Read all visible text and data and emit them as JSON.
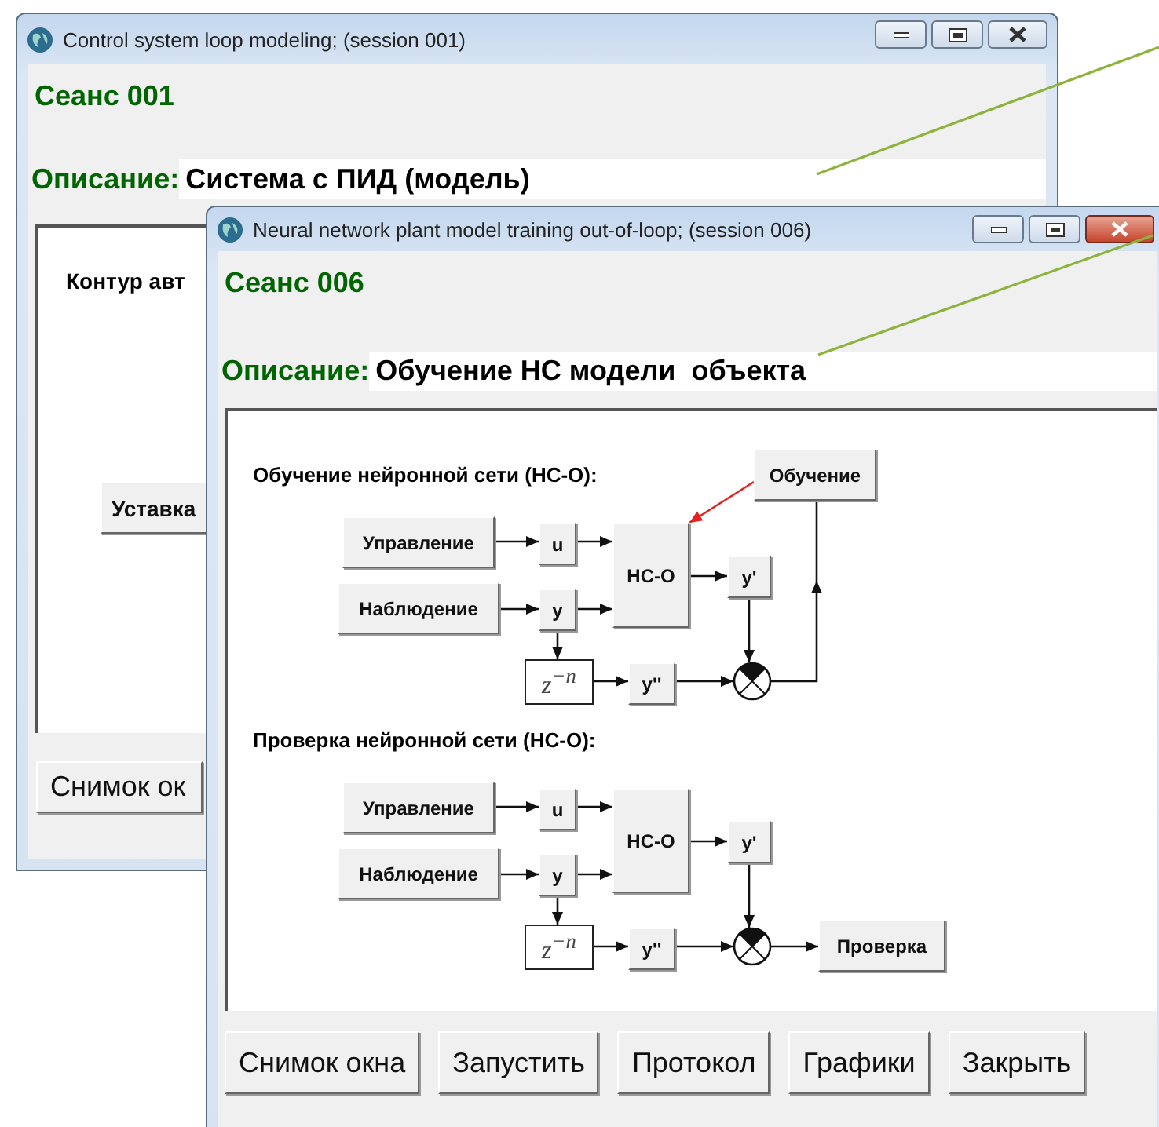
{
  "back_window": {
    "title": "Control system loop modeling; (session 001)",
    "active": false,
    "session": "Сеанс 001",
    "description_label": "Описание:",
    "description": "Система с ПИД (модель)",
    "panel_title": "Контур авт",
    "panel_button": "Уставка",
    "buttons": [
      "Снимок ок"
    ]
  },
  "front_window": {
    "title": "Neural network plant model training out-of-loop; (session 006)",
    "active": true,
    "session": "Сеанс 006",
    "description_label": "Описание:",
    "description": "Обучение НС модели  объекта",
    "diagram": {
      "sections": [
        {
          "kind": "training",
          "title": "Обучение нейронной сети (НС-О):",
          "control": "Управление",
          "observation": "Наблюдение",
          "u": "u",
          "y": "y",
          "model": "НС-О",
          "model_output": "y'",
          "delay": "z$^{−n}$",
          "delayed": "y''",
          "target": "Обучение"
        },
        {
          "kind": "check",
          "title": "Проверка нейронной сети (НС-О):",
          "control": "Управление",
          "observation": "Наблюдение",
          "u": "u",
          "y": "y",
          "model": "НС-О",
          "model_output": "y'",
          "delay": "z$^{−n}$",
          "delayed": "y''",
          "target": "Проверка"
        }
      ]
    },
    "buttons": [
      "Снимок окна",
      "Запустить",
      "Протокол",
      "Графики",
      "Закрыть"
    ]
  }
}
